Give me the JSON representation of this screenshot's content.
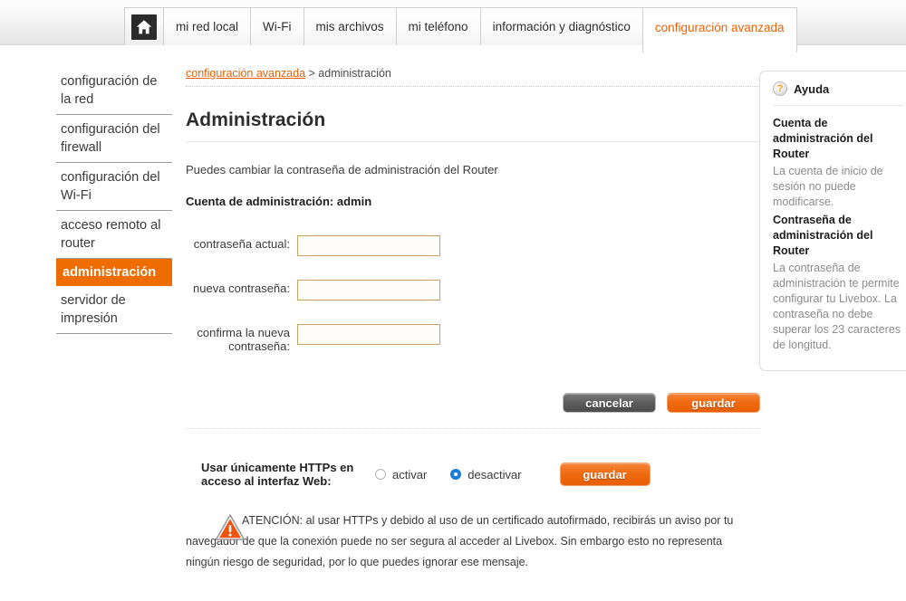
{
  "topnav": {
    "home_icon": "home-icon",
    "tabs": [
      {
        "label": "mi red local",
        "active": false
      },
      {
        "label": "Wi-Fi",
        "active": false
      },
      {
        "label": "mis archivos",
        "active": false
      },
      {
        "label": "mi teléfono",
        "active": false
      },
      {
        "label": "información y diagnóstico",
        "active": false
      },
      {
        "label": "configuración avanzada",
        "active": true
      }
    ]
  },
  "sidebar": {
    "items": [
      {
        "label": "configuración de la red",
        "active": false
      },
      {
        "label": "configuración del firewall",
        "active": false
      },
      {
        "label": "configuración del Wi-Fi",
        "active": false
      },
      {
        "label": "acceso remoto al router",
        "active": false
      },
      {
        "label": "administración",
        "active": true
      },
      {
        "label": "servidor de impresión",
        "active": false
      }
    ]
  },
  "breadcrumb": {
    "link": "configuración avanzada",
    "separator": ">",
    "current": "administración"
  },
  "main": {
    "title": "Administración",
    "intro": "Puedes cambiar la contraseña de administración del Router",
    "account_line": "Cuenta de administración: admin",
    "fields": [
      {
        "label": "contraseña actual:",
        "value": "",
        "placeholder": ""
      },
      {
        "label": "nueva contraseña:",
        "value": "",
        "placeholder": ""
      },
      {
        "label": "confirma la nueva contraseña:",
        "value": "",
        "placeholder": ""
      }
    ],
    "buttons": {
      "cancel": "cancelar",
      "save": "guardar"
    },
    "https": {
      "label": "Usar únicamente HTTPs en acceso al interfaz Web:",
      "options": [
        {
          "label": "activar",
          "selected": false
        },
        {
          "label": "desactivar",
          "selected": true
        }
      ],
      "save": "guardar"
    },
    "warning": {
      "icon": "warning-triangle-icon",
      "text": "ATENCIÓN: al usar HTTPs y debido al uso de un certificado autofirmado, recibirás un aviso por tu navegador de que la conexión puede no ser segura al acceder al Livebox. Sin embargo esto no representa ningún riesgo de seguridad, por lo que puedes ignorar ese mensaje."
    }
  },
  "help": {
    "icon": "question-mark-icon",
    "title": "Ayuda",
    "sections": [
      {
        "heading": "Cuenta de administración del Router",
        "body": "La cuenta de inicio de sesión no puede modificarse."
      },
      {
        "heading": "Contraseña de administración del Router",
        "body": "La contraseña de administración te permite configurar tu Livebox. La contraseña no debe superar los 23 caracteres de longitud."
      }
    ]
  },
  "colors": {
    "accent_orange": "#e8630a",
    "active_nav_orange": "#ef6c00",
    "field_border": "#cba164",
    "radio_blue": "#1a7fe0",
    "help_text_gray": "#8c8c8c"
  }
}
